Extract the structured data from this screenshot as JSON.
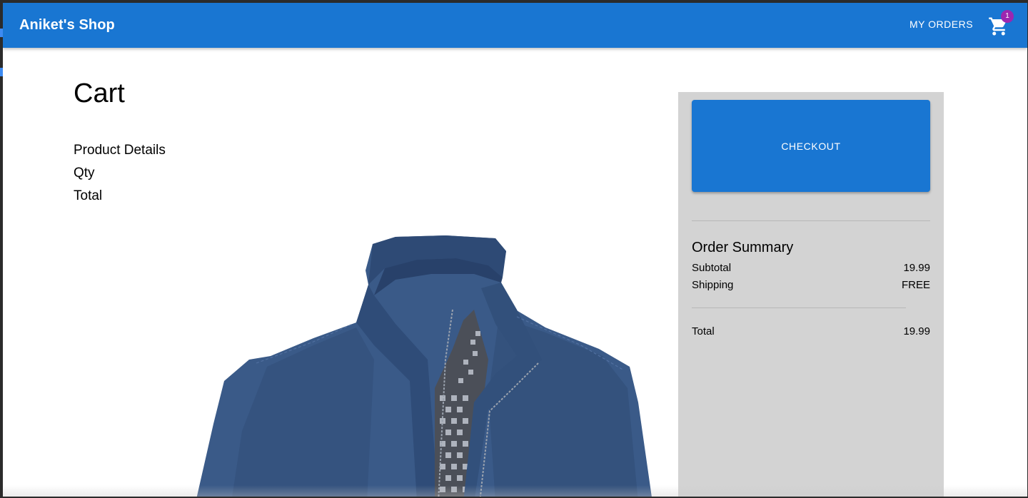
{
  "header": {
    "brand": "Aniket's Shop",
    "my_orders_label": "MY ORDERS",
    "cart_count": "1",
    "cart_icon": "shopping-cart-icon",
    "bar_color": "#1976d2",
    "badge_color": "#9c27b0"
  },
  "cart": {
    "title": "Cart",
    "columns": [
      "Product Details",
      "Qty",
      "Total"
    ],
    "product_image": "blue-zip-jacket-image"
  },
  "summary": {
    "checkout_label": "CHECKOUT",
    "heading": "Order Summary",
    "rows": [
      {
        "label": "Subtotal",
        "value": "19.99"
      },
      {
        "label": "Shipping",
        "value": "FREE"
      }
    ],
    "total_label": "Total",
    "total_value": "19.99",
    "panel_color": "#d3d3d3"
  }
}
